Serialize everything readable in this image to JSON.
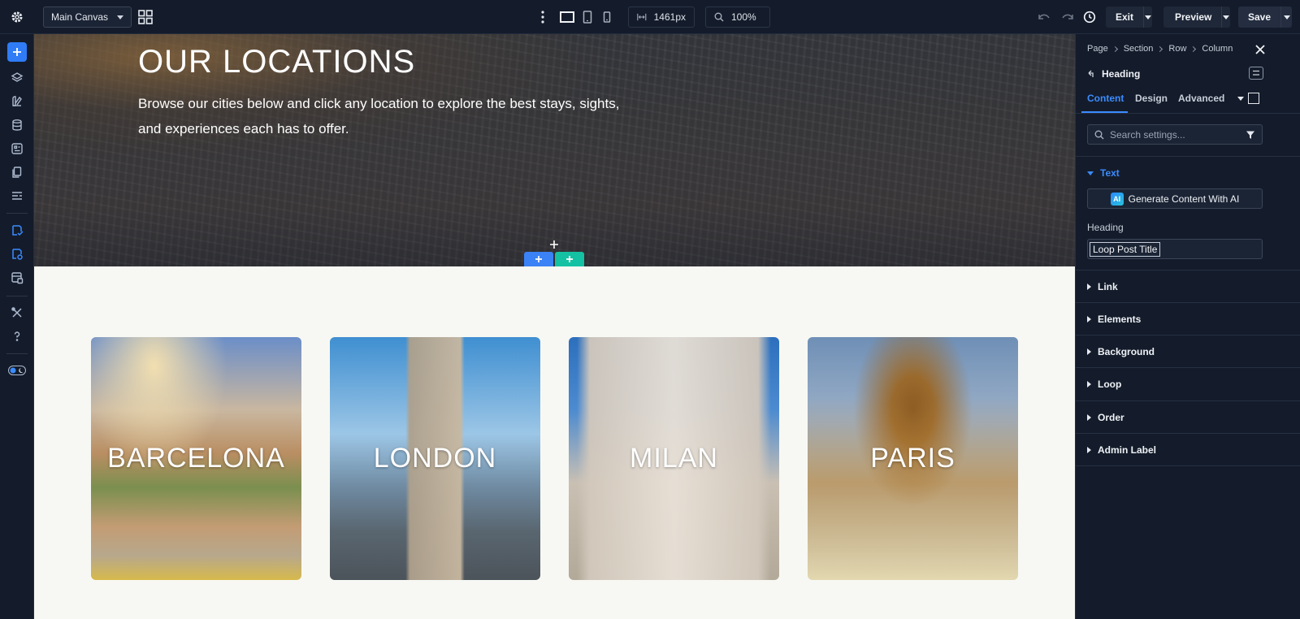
{
  "toolbar": {
    "canvas_selector": "Main Canvas",
    "width_value": "1461px",
    "zoom_value": "100%",
    "exit_label": "Exit",
    "preview_label": "Preview",
    "save_label": "Save"
  },
  "hero": {
    "title": "OUR LOCATIONS",
    "subtitle": "Browse our cities below and click any location to explore the best stays, sights, and experiences each has to offer."
  },
  "cards": [
    {
      "label": "BARCELONA"
    },
    {
      "label": "LONDON"
    },
    {
      "label": "MILAN"
    },
    {
      "label": "PARIS"
    }
  ],
  "panel": {
    "breadcrumb": [
      "Page",
      "Section",
      "Row",
      "Column"
    ],
    "element_title": "Heading",
    "tabs": [
      "Content",
      "Design",
      "Advanced"
    ],
    "search_placeholder": "Search settings...",
    "text_section": "Text",
    "ai_button": "Generate Content With AI",
    "ai_badge": "AI",
    "heading_label": "Heading",
    "heading_value": "Loop Post Title",
    "sections": [
      "Link",
      "Elements",
      "Background",
      "Loop",
      "Order",
      "Admin Label"
    ]
  },
  "colors": {
    "accent": "#3b8cff",
    "add_section": "#3b82f6",
    "add_row": "#14c2a3",
    "chrome": "#141c2b"
  }
}
